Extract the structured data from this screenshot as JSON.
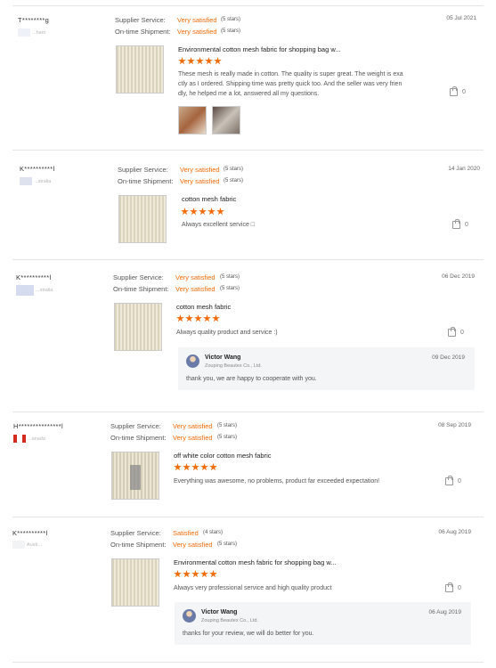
{
  "labels": {
    "supplier_service": "Supplier Service:",
    "ontime_shipment": "On-time Shipment:"
  },
  "accent": "#f26b0a",
  "reviews": [
    {
      "name": "T********g",
      "country": "...ham",
      "supplier_rating": "Very satisfied",
      "supplier_stars": "(5 stars)",
      "ontime_rating": "Very satisfied",
      "ontime_stars": "(5 stars)",
      "date": "05 Jul 2021",
      "product_title": "Environmental cotton mesh fabric for shopping bag w...",
      "stars": 5,
      "comment": [
        "These mesh is really made in cotton. The quality is super great. The weight is exa",
        "ctly as I ordered. Shipping time was pretty quick too. And the seller was very frien",
        "dly, he helped me a lot, answered all my questions."
      ],
      "likes": "0"
    },
    {
      "name": "K**********l",
      "country": "...stralia",
      "supplier_rating": "Very satisfied",
      "supplier_stars": "(5 stars)",
      "ontime_rating": "Very satisfied",
      "ontime_stars": "(5 stars)",
      "date": "14 Jan 2020",
      "product_title": "cotton mesh fabric",
      "stars": 5,
      "comment": [
        "Always excellent service □"
      ],
      "likes": "0"
    },
    {
      "name": "K**********l",
      "country": "...stralia",
      "supplier_rating": "Very satisfied",
      "supplier_stars": "(5 stars)",
      "ontime_rating": "Very satisfied",
      "ontime_stars": "(5 stars)",
      "date": "06 Dec 2019",
      "product_title": "cotton mesh fabric",
      "stars": 5,
      "comment": [
        "Always quality product and service :)"
      ],
      "likes": "0",
      "reply": {
        "name": "Victor Wang",
        "company": "Zouping Beautex Co., Ltd.",
        "date": "09 Dec 2019",
        "text": "thank you, we are happy to cooperate with you."
      }
    },
    {
      "name": "H***************l",
      "country": "...anada",
      "supplier_rating": "Very satisfied",
      "supplier_stars": "(5 stars)",
      "ontime_rating": "Very satisfied",
      "ontime_stars": "(5 stars)",
      "date": "08 Sep 2019",
      "product_title": "off white color cotton mesh fabric",
      "stars": 5,
      "comment": [
        "Everything was awesome, no problems, product far exceeded expectation!"
      ],
      "likes": "0"
    },
    {
      "name": "K**********l",
      "country": "Austr...",
      "supplier_rating": "Satisfied",
      "supplier_stars": "(4 stars)",
      "ontime_rating": "Very satisfied",
      "ontime_stars": "(5 stars)",
      "date": "06 Aug 2019",
      "product_title": "Environmental cotton mesh fabric for shopping bag w...",
      "stars": 5,
      "comment": [
        "Always very professional service and high quality product"
      ],
      "likes": "0",
      "reply": {
        "name": "Victor Wang",
        "company": "Zouping Beautex Co., Ltd.",
        "date": "06 Aug 2019",
        "text": "thanks for your review, we will do better for you."
      }
    }
  ]
}
